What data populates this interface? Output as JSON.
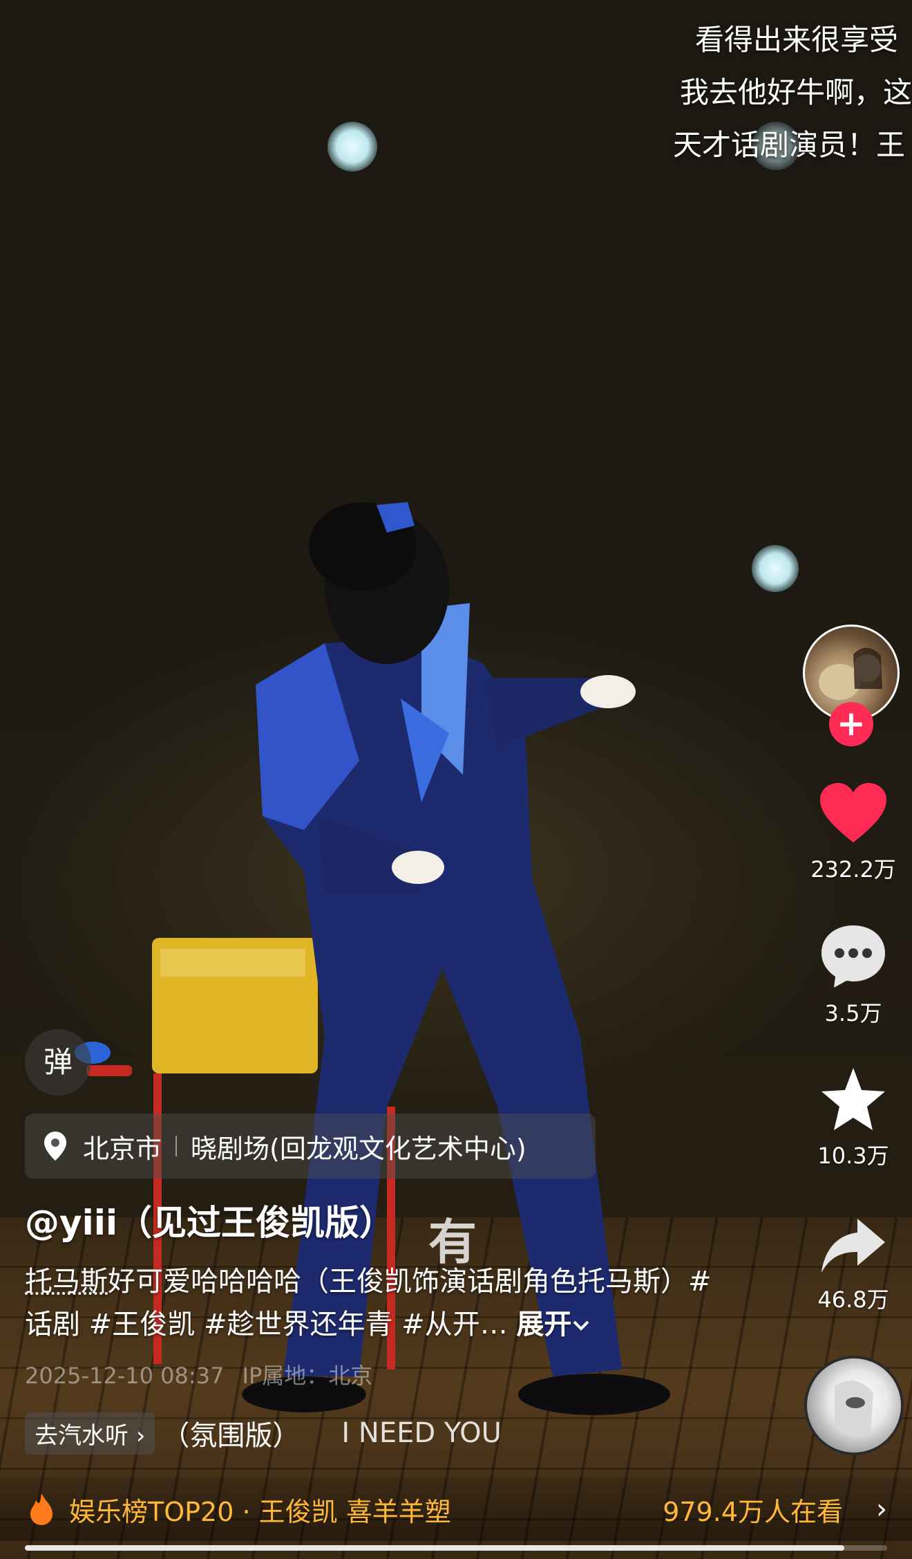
{
  "comment_overlay": [
    "看得出来很享受",
    "我去他好牛啊，这",
    "天才话剧演员！王"
  ],
  "side_actions": {
    "likes": "232.2万",
    "comments": "3.5万",
    "favorites": "10.3万",
    "shares": "46.8万"
  },
  "danmu_label": "弹",
  "location": {
    "city": "北京市",
    "venue": "晓剧场(回龙观文化艺术中心)"
  },
  "author": "@yiii（见过王俊凯版）",
  "lyric_char": "有",
  "description": {
    "highlight": "托马斯",
    "text": "好可爱哈哈哈哈（王俊凯饰演话剧角色托马斯）#话剧 #王俊凯 #趁世界还年青 #从开…",
    "expand": "展开"
  },
  "meta": {
    "datetime": "2025-12-10 08:37",
    "ip": "IP属地：北京"
  },
  "music": {
    "button": "去汽水听",
    "song": "（氛围版）",
    "song_extra": "I NEED YOU"
  },
  "hot_bar": {
    "title": "娱乐榜TOP20 · 王俊凯 喜羊羊塑",
    "views": "979.4万人在看"
  },
  "progress": {
    "fraction": 0.95
  },
  "colors": {
    "like": "#fe2c55",
    "hot": "#ffb838"
  }
}
